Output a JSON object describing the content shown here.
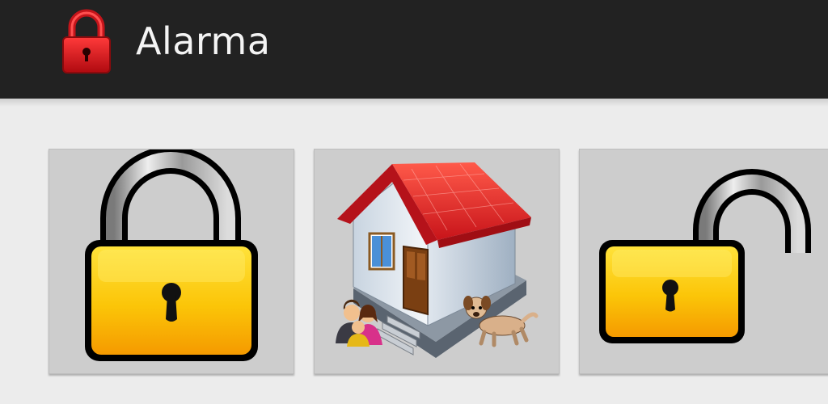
{
  "appbar": {
    "title": "Alarma",
    "icon": "red-padlock-icon"
  },
  "tiles": [
    {
      "name": "lock",
      "icon": "closed-padlock-icon"
    },
    {
      "name": "home",
      "icon": "house-family-dog-icon"
    },
    {
      "name": "unlock",
      "icon": "open-padlock-icon"
    }
  ],
  "colors": {
    "appbar_bg": "#222222",
    "page_bg": "#ececec",
    "tile_bg": "#cdcdcd",
    "lock_body": "#f6b800",
    "app_icon_red": "#d8141a",
    "roof_red": "#e52525"
  }
}
